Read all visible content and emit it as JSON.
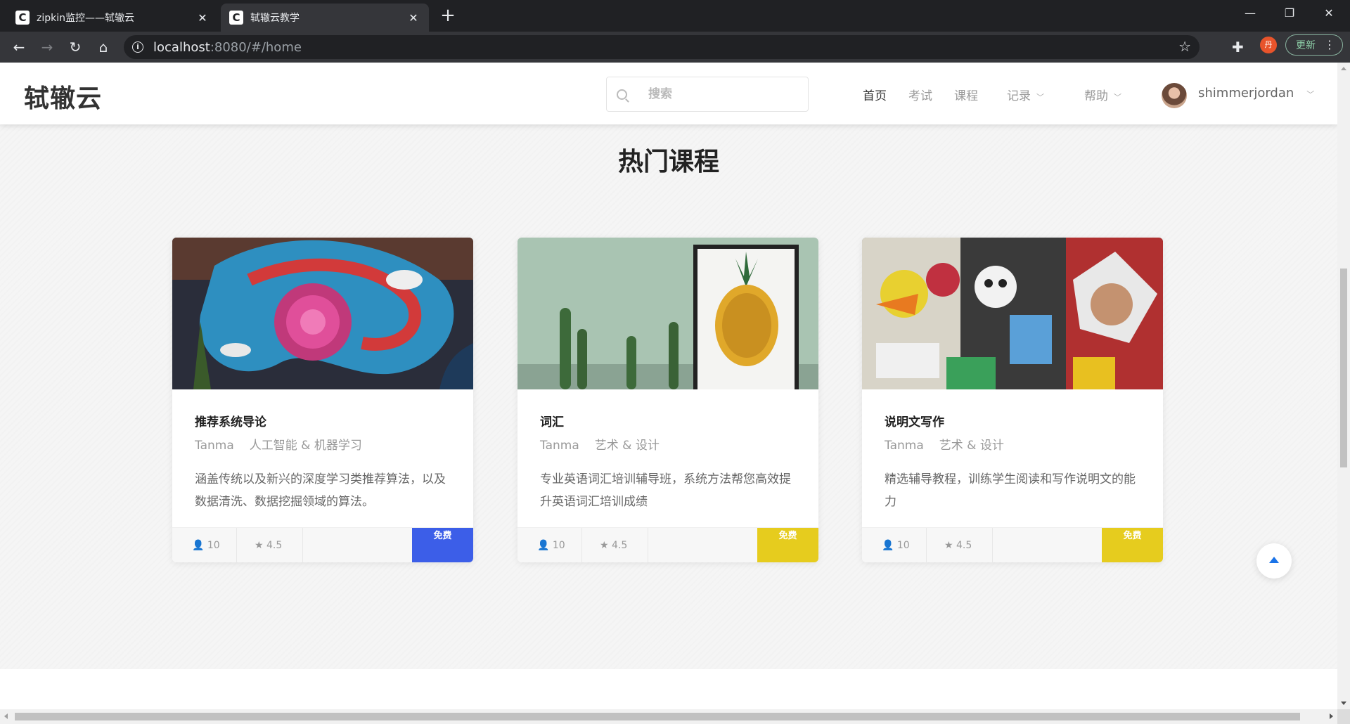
{
  "browser": {
    "tabs": [
      {
        "favicon": "C",
        "title": "zipkin监控——轼辙云"
      },
      {
        "favicon": "C",
        "title": "轼辙云教学"
      }
    ],
    "url_host": "localhost",
    "url_rest": ":8080/#/home",
    "profile_initial": "丹",
    "update_label": "更新",
    "icons": {
      "back": "arrow-left-icon",
      "forward": "arrow-right-icon",
      "reload": "reload-icon",
      "home": "home-icon",
      "star": "star-icon",
      "extensions": "puzzle-icon",
      "menu": "kebab-menu-icon"
    },
    "colors": {
      "tabbar": "#202124",
      "toolbar": "#35363a",
      "profile": "#e8542b",
      "update": "#8ecfa8"
    }
  },
  "header": {
    "logo": "轼辙云",
    "search_placeholder": "搜索",
    "nav": [
      {
        "label": "首页",
        "active": true
      },
      {
        "label": "考试"
      },
      {
        "label": "课程"
      },
      {
        "label": "记录",
        "dropdown": true
      },
      {
        "label": "帮助",
        "dropdown": true
      }
    ],
    "username": "shimmerjordan"
  },
  "section_title": "热门课程",
  "courses": [
    {
      "title": "推荐系统导论",
      "author": "Tanma",
      "category": "人工智能 & 机器学习",
      "description": "涵盖传统以及新兴的深度学习类推荐算法，以及数据清洗、数据挖掘领域的算法。",
      "students": "10",
      "rating": "4.5",
      "price_label": "免费",
      "badge_color": "#3c5ee8",
      "image": "graffiti-mural-image"
    },
    {
      "title": "词汇",
      "author": "Tanma",
      "category": "艺术 & 设计",
      "description": "专业英语词汇培训辅导班，系统方法帮您高效提升英语词汇培训成绩",
      "students": "10",
      "rating": "4.5",
      "price_label": "免费",
      "badge_color": "#e6cc1e",
      "image": "pineapple-cactus-image"
    },
    {
      "title": "说明文写作",
      "author": "Tanma",
      "category": "艺术 & 设计",
      "description": "精选辅导教程，训练学生阅读和写作说明文的能力",
      "students": "10",
      "rating": "4.5",
      "price_label": "免费",
      "badge_color": "#e6cc1e",
      "image": "street-art-collage-image"
    }
  ]
}
